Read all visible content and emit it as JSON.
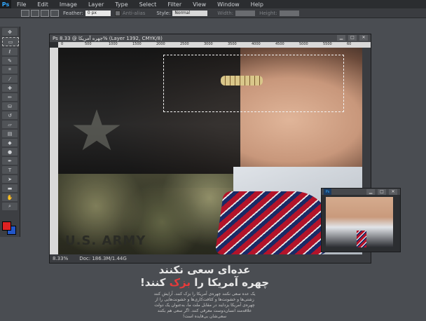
{
  "menubar": {
    "logo": "Ps",
    "items": [
      "File",
      "Edit",
      "Image",
      "Layer",
      "Type",
      "Select",
      "Filter",
      "View",
      "Window",
      "Help"
    ]
  },
  "options": {
    "feather_label": "Feather:",
    "feather_value": "0 px",
    "antialias_label": "Anti-alias",
    "style_label": "Style:",
    "style_value": "Normal",
    "width_label": "Width:",
    "height_label": "Height:"
  },
  "document": {
    "title": "Ps  جهره آمریکا @ 8.33% (Layer 1392, CMYK/8)",
    "ruler_ticks": [
      "0",
      "500",
      "1000",
      "1500",
      "2000",
      "2500",
      "3000",
      "3500",
      "4000",
      "4500",
      "5000",
      "5500",
      "60"
    ],
    "army_text": "U.S. ARMY",
    "zoom": "8.33%",
    "doc_size": "Doc: 186.3M/1.44G"
  },
  "caption": {
    "title_line1": "عده‌ای سعی نکنند",
    "title_line2_pre": "چهره آمریکا را ",
    "title_line2_hl": "بزک",
    "title_line2_post": " کنند!",
    "body": "یک عده سعی نکنند چهره‌ی آمریکا را بزک کنند. آرایش کنند زشتی‌ها و خشونت‌ها و کثافت‌کاری‌ها و خشونت‌هایی را از چهره‌ی آمریکا بزدایند در مقابل ملت ما، به‌عنوان یک دولت علاقه‌مند انسان‌دوست معرفی کنند. اگر سعی هم بکنند سعی‌شان بی‌فایده است!"
  },
  "colors": {
    "foreground": "#dd2222",
    "background": "#2256c9",
    "highlight": "#e63a3a"
  }
}
